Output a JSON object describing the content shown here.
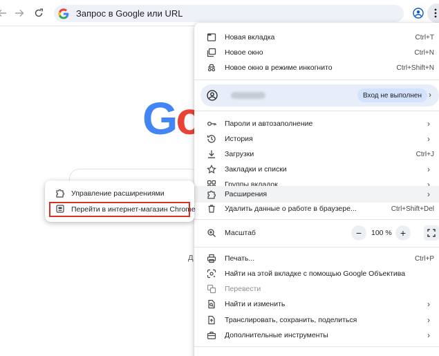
{
  "toolbar": {
    "back_icon": "arrow-left-icon",
    "forward_icon": "arrow-right-icon",
    "reload_icon": "reload-icon",
    "omnibox_placeholder": "Запрос в Google или URL",
    "profile_icon": "account-circle-icon",
    "menu_icon": "three-dots-vertical-icon"
  },
  "new_tab_page": {
    "logo_partial": [
      "G",
      "o"
    ],
    "partial_hint_char": "д"
  },
  "menu": {
    "new_tab": {
      "label": "Новая вкладка",
      "shortcut": "Ctrl+T"
    },
    "new_window": {
      "label": "Новое окно",
      "shortcut": "Ctrl+N"
    },
    "incognito": {
      "label": "Новое окно в режиме инкогнито",
      "shortcut": "Ctrl+Shift+N"
    },
    "profile": {
      "name": "",
      "status": "Вход не выполнен"
    },
    "passwords": {
      "label": "Пароли и автозаполнение"
    },
    "history": {
      "label": "История"
    },
    "downloads": {
      "label": "Загрузки",
      "shortcut": "Ctrl+J"
    },
    "bookmarks": {
      "label": "Закладки и списки"
    },
    "tab_groups": {
      "label": "Группы вкладок"
    },
    "extensions": {
      "label": "Расширения"
    },
    "clear_data": {
      "label": "Удалить данные о работе в браузере...",
      "shortcut": "Ctrl+Shift+Del"
    },
    "zoom": {
      "label": "Масштаб",
      "value": "100 %",
      "minus": "−",
      "plus": "+"
    },
    "print": {
      "label": "Печать...",
      "shortcut": "Ctrl+P"
    },
    "lens": {
      "label": "Найти на этой вкладке с помощью Google Объектива"
    },
    "translate": {
      "label": "Перевести"
    },
    "find": {
      "label": "Найти и изменить"
    },
    "cast": {
      "label": "Транслировать, сохранить, поделиться"
    },
    "more_tools": {
      "label": "Дополнительные инструменты"
    }
  },
  "extensions_submenu": {
    "manage": {
      "label": "Управление расширениями"
    },
    "store": {
      "label": "Перейти в интернет-магазин Chrome"
    }
  },
  "colors": {
    "highlight_border": "#d93025",
    "google_blue": "#4285f4",
    "google_red": "#ea4335",
    "profile_bg": "#e8eef9",
    "badge_bg": "#d3e3fd"
  }
}
